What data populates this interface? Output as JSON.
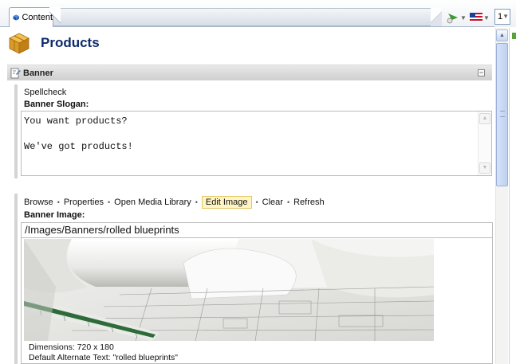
{
  "tab": {
    "label": "Content"
  },
  "toolbar_top": {
    "page_number": "1"
  },
  "header": {
    "title": "Products"
  },
  "section": {
    "title": "Banner"
  },
  "slogan_field": {
    "spellcheck_label": "Spellcheck",
    "label": "Banner Slogan:",
    "value": "You want products?\n\nWe've got products!"
  },
  "image_field": {
    "actions": [
      "Browse",
      "Properties",
      "Open Media Library",
      "Edit Image",
      "Clear",
      "Refresh"
    ],
    "active_action": "Edit Image",
    "label": "Banner Image:",
    "path": "/Images/Banners/rolled blueprints",
    "dimensions": "Dimensions: 720 x 180",
    "alt_text": "Default Alternate Text: \"rolled blueprints\""
  },
  "colors": {
    "title_blue": "#0e2a6c",
    "active_action_bg": "#fff5c4"
  }
}
